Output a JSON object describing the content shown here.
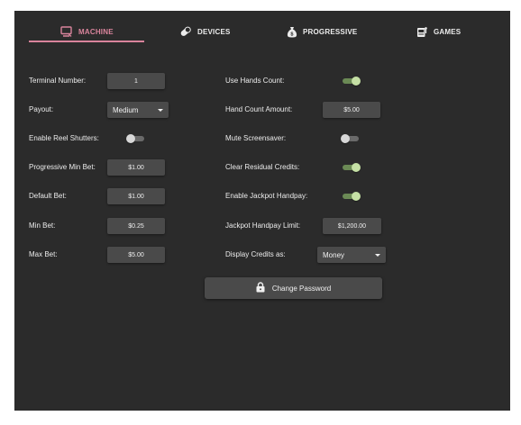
{
  "tabs": [
    {
      "label": "MACHINE",
      "icon": "machine-icon",
      "active": true
    },
    {
      "label": "DEVICES",
      "icon": "pill-icon",
      "active": false
    },
    {
      "label": "PROGRESSIVE",
      "icon": "money-bag-icon",
      "active": false
    },
    {
      "label": "GAMES",
      "icon": "slot-machine-icon",
      "active": false
    }
  ],
  "left": {
    "terminal_number": {
      "label": "Terminal Number:",
      "value": "1"
    },
    "payout": {
      "label": "Payout:",
      "value": "Medium"
    },
    "enable_reel_shutters": {
      "label": "Enable Reel Shutters:",
      "on": false
    },
    "progressive_min_bet": {
      "label": "Progressive Min Bet:",
      "value": "$1.00"
    },
    "default_bet": {
      "label": "Default Bet:",
      "value": "$1.00"
    },
    "min_bet": {
      "label": "Min Bet:",
      "value": "$0.25"
    },
    "max_bet": {
      "label": "Max Bet:",
      "value": "$5.00"
    }
  },
  "right": {
    "use_hands_count": {
      "label": "Use Hands Count:",
      "on": true
    },
    "hand_count_amount": {
      "label": "Hand Count Amount:",
      "value": "$5.00"
    },
    "mute_screensaver": {
      "label": "Mute Screensaver:",
      "on": false
    },
    "clear_residual_credits": {
      "label": "Clear Residual Credits:",
      "on": true
    },
    "enable_jackpot_handpay": {
      "label": "Enable Jackpot Handpay:",
      "on": true
    },
    "jackpot_handpay_limit": {
      "label": "Jackpot Handpay Limit:",
      "value": "$1,200.00"
    },
    "display_credits_as": {
      "label": "Display Credits as:",
      "value": "Money"
    }
  },
  "change_password": {
    "label": "Change Password",
    "icon": "lock-icon"
  },
  "colors": {
    "panel_bg": "#2b2b2b",
    "accent": "#d9849c",
    "field_bg": "#4a4a4a",
    "toggle_on_track": "#6b8a55",
    "toggle_on_thumb": "#c5e0a5"
  }
}
